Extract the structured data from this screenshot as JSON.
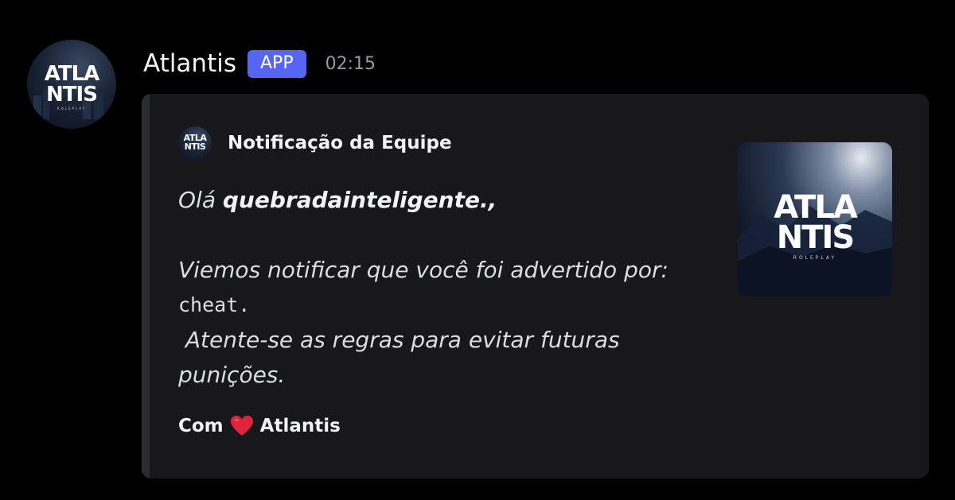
{
  "message": {
    "username": "Atlantis",
    "tag": "APP",
    "timestamp": "02:15",
    "avatar_logo": {
      "line1": "ATLA",
      "line2": "NTIS",
      "sub": "ROLEPLAY"
    }
  },
  "embed": {
    "author": "Notificação da Equipe",
    "greeting_prefix": "Olá ",
    "recipient": "quebradainteligente.",
    "greeting_suffix": ",",
    "line_notify": "Viemos notificar que você foi advertido por:",
    "reason": "cheat.",
    "line_warn_1": " Atente-se as regras para evitar futuras",
    "line_warn_2": "punições.",
    "footer_prefix": "Com",
    "footer_emoji": "red-heart-emoji",
    "footer_suffix": "Atlantis",
    "thumbnail_logo": {
      "line1": "ATLA",
      "line2": "NTIS",
      "sub": "ROLEPLAY"
    }
  },
  "colors": {
    "background": "#000000",
    "embed_bg": "#17171c",
    "accent_bar": "#2b2d31",
    "app_tag": "#5865f2",
    "timestamp": "#949ba4",
    "heart": "#e0243a"
  }
}
